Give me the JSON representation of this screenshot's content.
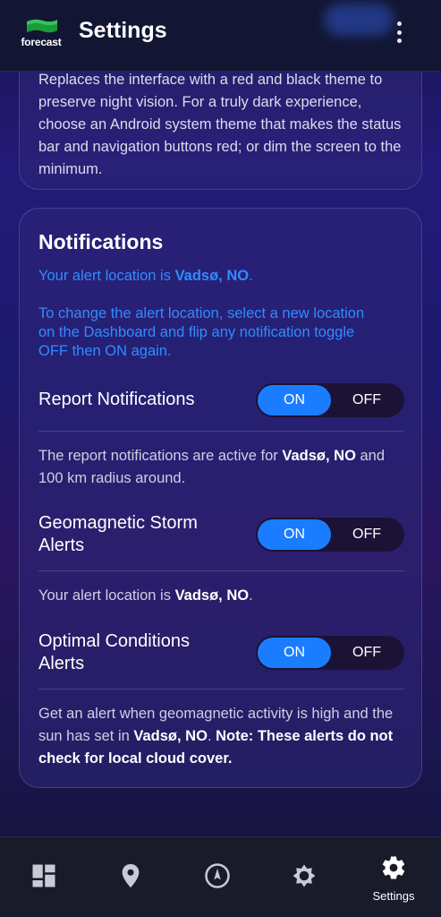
{
  "app_bar": {
    "logo_text": "forecast",
    "title": "Settings",
    "menu_icon": "more-vert-icon"
  },
  "night_mode_card": {
    "description": "Replaces the interface with a red and black theme to preserve night vision. For a truly dark experience, choose an Android system theme that makes the status bar and navigation buttons red; or dim the screen to the minimum."
  },
  "notifications": {
    "title": "Notifications",
    "alert_prefix": "Your alert location is ",
    "alert_location": "Vadsø, NO",
    "alert_suffix": ".",
    "change_instructions": "To change the alert location, select a new location on the Dashboard and flip any notification toggle OFF then ON again.",
    "toggle_on_label": "ON",
    "toggle_off_label": "OFF",
    "settings": [
      {
        "label": "Report Notifications",
        "state": "ON",
        "desc_prefix": "The report notifications are active for ",
        "desc_location": "Vadsø, NO",
        "desc_suffix": " and 100 km radius around."
      },
      {
        "label": "Geomagnetic Storm Alerts",
        "state": "ON",
        "desc_prefix": "Your alert location is ",
        "desc_location": "Vadsø, NO",
        "desc_suffix": "."
      },
      {
        "label": "Optimal Conditions Alerts",
        "state": "ON",
        "desc_prefix": "Get an alert when geomagnetic activity is high and the sun has set in ",
        "desc_location": "Vadsø, NO",
        "desc_suffix": ". ",
        "desc_note": "Note: These alerts do not check for local cloud cover."
      }
    ]
  },
  "bottom_nav": {
    "items": [
      {
        "icon": "dashboard-icon",
        "label": ""
      },
      {
        "icon": "location-pin-icon",
        "label": ""
      },
      {
        "icon": "compass-icon",
        "label": ""
      },
      {
        "icon": "sun-icon",
        "label": ""
      },
      {
        "icon": "gear-icon",
        "label": "Settings"
      }
    ],
    "active_index": 4
  },
  "colors": {
    "accent_blue": "#2f8cff",
    "toggle_on": "#1a7dff",
    "app_bar_bg": "#121633",
    "logo_green": "#1e9a3c"
  }
}
